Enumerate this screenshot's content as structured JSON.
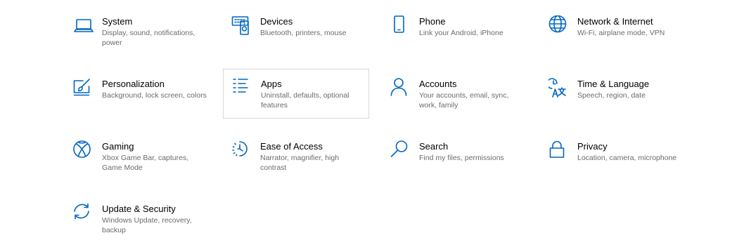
{
  "tiles": [
    {
      "key": "system",
      "title": "System",
      "desc": "Display, sound, notifications, power",
      "icon": "laptop-icon"
    },
    {
      "key": "devices",
      "title": "Devices",
      "desc": "Bluetooth, printers, mouse",
      "icon": "devices-icon"
    },
    {
      "key": "phone",
      "title": "Phone",
      "desc": "Link your Android, iPhone",
      "icon": "phone-icon"
    },
    {
      "key": "network",
      "title": "Network & Internet",
      "desc": "Wi-Fi, airplane mode, VPN",
      "icon": "globe-icon"
    },
    {
      "key": "personalization",
      "title": "Personalization",
      "desc": "Background, lock screen, colors",
      "icon": "paintbrush-icon"
    },
    {
      "key": "apps",
      "title": "Apps",
      "desc": "Uninstall, defaults, optional features",
      "icon": "apps-list-icon",
      "selected": true
    },
    {
      "key": "accounts",
      "title": "Accounts",
      "desc": "Your accounts, email, sync, work, family",
      "icon": "person-icon"
    },
    {
      "key": "time",
      "title": "Time & Language",
      "desc": "Speech, region, date",
      "icon": "time-language-icon"
    },
    {
      "key": "gaming",
      "title": "Gaming",
      "desc": "Xbox Game Bar, captures, Game Mode",
      "icon": "xbox-icon"
    },
    {
      "key": "ease",
      "title": "Ease of Access",
      "desc": "Narrator, magnifier, high contrast",
      "icon": "ease-of-access-icon"
    },
    {
      "key": "search",
      "title": "Search",
      "desc": "Find my files, permissions",
      "icon": "search-icon"
    },
    {
      "key": "privacy",
      "title": "Privacy",
      "desc": "Location, camera, microphone",
      "icon": "lock-icon"
    },
    {
      "key": "update",
      "title": "Update & Security",
      "desc": "Windows Update, recovery, backup",
      "icon": "sync-icon"
    }
  ],
  "colors": {
    "accent": "#0067c0",
    "title": "#000000",
    "description": "#6b6b6b",
    "selection_border": "#d9d9d9"
  }
}
